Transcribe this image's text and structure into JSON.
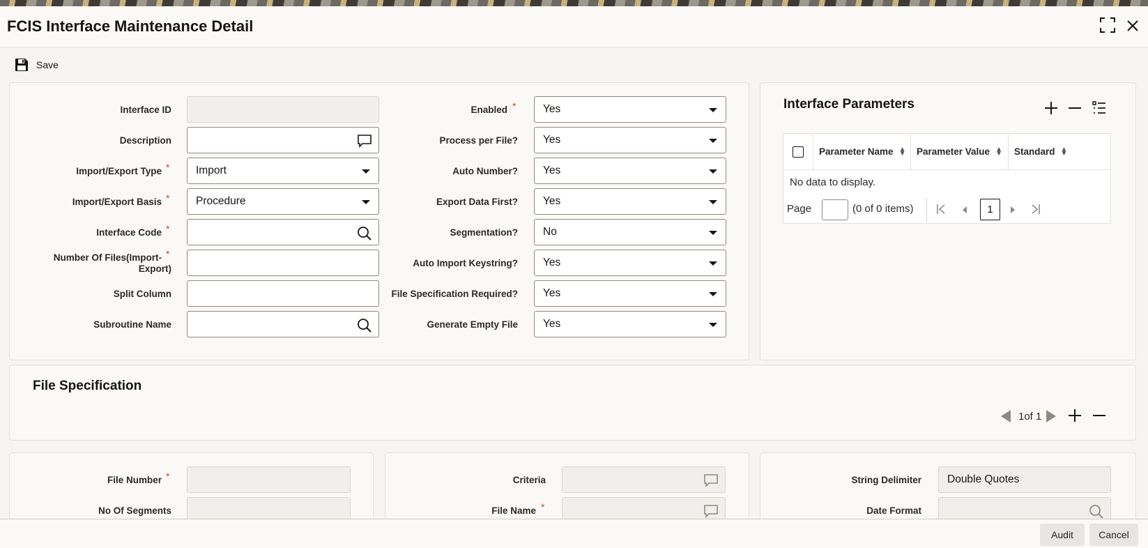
{
  "window": {
    "title": "FCIS Interface Maintenance Detail"
  },
  "toolbar": {
    "save_label": "Save"
  },
  "left_fields": [
    {
      "label": "Interface ID",
      "value": "",
      "required": false
    },
    {
      "label": "Description",
      "value": "",
      "required": false
    },
    {
      "label": "Import/Export Type",
      "value": "Import",
      "required": true
    },
    {
      "label": "Import/Export Basis",
      "value": "Procedure",
      "required": true
    },
    {
      "label": "Interface Code",
      "value": "",
      "required": true
    },
    {
      "label_line1": "Number Of Files(Import-",
      "label_line2": "Export)",
      "value": "",
      "required": true
    },
    {
      "label": "Split Column",
      "value": "",
      "required": false
    },
    {
      "label": "Subroutine Name",
      "value": "",
      "required": false
    }
  ],
  "right_fields": [
    {
      "label": "Enabled",
      "value": "Yes",
      "required": true
    },
    {
      "label": "Process per File?",
      "value": "Yes"
    },
    {
      "label": "Auto Number?",
      "value": "Yes"
    },
    {
      "label": "Export Data First?",
      "value": "Yes"
    },
    {
      "label": "Segmentation?",
      "value": "No"
    },
    {
      "label": "Auto Import Keystring?",
      "value": "Yes"
    },
    {
      "label": "File Specification Required?",
      "value": "Yes"
    },
    {
      "label": "Generate Empty File",
      "value": "Yes"
    }
  ],
  "interface_parameters": {
    "title": "Interface Parameters",
    "columns": [
      "Parameter Name",
      "Parameter Value",
      "Standard"
    ],
    "empty_text": "No data to display.",
    "page_label": "Page",
    "items_text": "(0 of 0 items)",
    "current_page": "1"
  },
  "file_spec": {
    "title": "File Specification",
    "pager_text": "1of 1"
  },
  "file_fields": {
    "file_number": "File Number",
    "no_of_segments": "No Of Segments",
    "criteria": "Criteria",
    "file_name": "File Name",
    "string_delimiter": "String Delimiter",
    "string_delimiter_value": "Double Quotes",
    "date_format": "Date Format"
  },
  "footer": {
    "audit_label": "Audit",
    "cancel_label": "Cancel"
  },
  "colors": {
    "required": "#c74634",
    "panel": "#faf9f7",
    "border": "#e4e1dc"
  }
}
